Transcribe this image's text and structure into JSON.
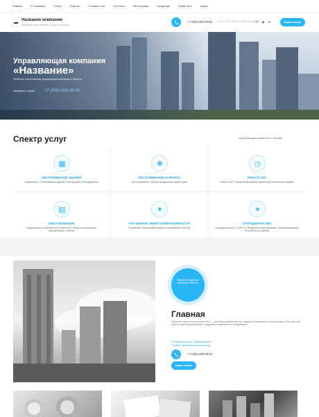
{
  "colors": {
    "accent": "#29b6f6",
    "text": "#222222",
    "muted": "#999999"
  },
  "topnav": [
    "Главная",
    "О компании",
    "Услуги",
    "Новости",
    "Отзывы о нас",
    "Контакты",
    "Регистрация",
    "Продукция",
    "Прайс-лист",
    "Акции"
  ],
  "header": {
    "company_name": "Название компании",
    "company_sub": "Наиболее качественные услуги в области",
    "phone": "+7 (000) 000-00-00",
    "hours": "Пн-Пт 9:00-18:00, Сб-Вс выходной",
    "socials": [
      "vk",
      "ok",
      "telegram"
    ],
    "order_button": "Задать вопрос"
  },
  "hero": {
    "title_line1": "Управляющая компания",
    "title_line2": "«Название»",
    "description": "Наиболее качественная управляющая компания в области",
    "emergency_label": "Аварийная служба",
    "emergency_phone": "+7 (000) 000-00-00"
  },
  "services": {
    "title": "Спектр услуг",
    "note": "Управляющая компания в г. Москве",
    "items": [
      {
        "icon": "building-icon",
        "title": "Обслуживание зданий",
        "text": "Содержание, обслуживание зданий, конструкций и оборудования"
      },
      {
        "icon": "cleaning-icon",
        "title": "Обслуживание и уборка",
        "text": "Обслуживание и уборка придомовых территорий"
      },
      {
        "icon": "clock-icon",
        "title": "Работа 24/7",
        "text": "Работа 24/7 специализированной единой диспетчерской службы"
      },
      {
        "icon": "document-icon",
        "title": "Обслуживание",
        "text": "Поддержание в рабочем состоянии мест общего пользования, водопроводов, лифтов"
      },
      {
        "icon": "energy-icon",
        "title": "Улучшение энергоэффективности",
        "text": "Улучшение энергоэффективности инженерных систем"
      },
      {
        "icon": "handshake-icon",
        "title": "Сотрудничество",
        "text": "Сотрудничество с ТСЖ и с соседними организациями, обеспечивающими безопасность района"
      }
    ]
  },
  "about": {
    "badge": "Наиболее надежная компания в области",
    "title": "Главная",
    "text": "Наиболее качественные услуги ЖКХ — мы обеспечиваем чистоту, порядок и безопасность в вашем доме. Большой опыт работы, квалифицированные сотрудники и современное оборудование.",
    "link1": "Остались вопросы? Задайте вопрос!",
    "link2": "Оставить предложение или жалобу",
    "phone": "+7 (000) 000-00-00",
    "button": "Задать вопрос"
  }
}
